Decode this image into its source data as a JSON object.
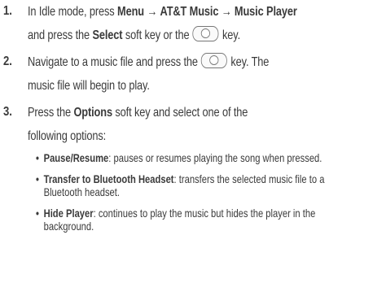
{
  "steps": [
    {
      "num": "1.",
      "lines": [
        {
          "a": "In Idle mode, press ",
          "b1": "Menu",
          "c": " → ",
          "b2": "AT&T Music",
          "d": " → ",
          "b3": "Music Player"
        },
        {
          "a": "and press the ",
          "b1": "Select",
          "c": " soft key or the ",
          "d": " key."
        }
      ]
    },
    {
      "num": "2.",
      "lines": [
        {
          "a": "Navigate to a music file and press the ",
          "b": " key. The"
        },
        {
          "a": "music file will begin to play."
        }
      ]
    },
    {
      "num": "3.",
      "lines": [
        {
          "a": "Press the ",
          "b1": "Options",
          "c": " soft key and select one of the"
        },
        {
          "a": "following options:"
        }
      ]
    }
  ],
  "options": [
    {
      "bullet": "•",
      "title": "Pause/Resume",
      "desc": ": pauses or resumes playing the song when pressed."
    },
    {
      "bullet": "•",
      "title": "Transfer to Bluetooth Headset",
      "desc": ": transfers the selected music file to a Bluetooth headset."
    },
    {
      "bullet": "•",
      "title": "Hide Player",
      "desc": ": continues to play the music but hides the player in the background."
    }
  ],
  "icons": {
    "select_key": "select-key-icon"
  }
}
